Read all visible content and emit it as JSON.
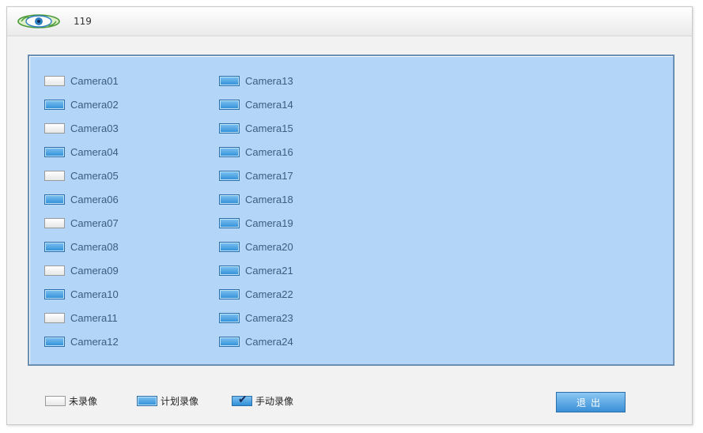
{
  "window": {
    "title": "119"
  },
  "cameras": {
    "column1": [
      {
        "label": "Camera01",
        "status": "none"
      },
      {
        "label": "Camera02",
        "status": "plan"
      },
      {
        "label": "Camera03",
        "status": "none"
      },
      {
        "label": "Camera04",
        "status": "plan"
      },
      {
        "label": "Camera05",
        "status": "none"
      },
      {
        "label": "Camera06",
        "status": "plan"
      },
      {
        "label": "Camera07",
        "status": "none"
      },
      {
        "label": "Camera08",
        "status": "plan"
      },
      {
        "label": "Camera09",
        "status": "none"
      },
      {
        "label": "Camera10",
        "status": "plan"
      },
      {
        "label": "Camera11",
        "status": "none"
      },
      {
        "label": "Camera12",
        "status": "plan"
      }
    ],
    "column2": [
      {
        "label": "Camera13",
        "status": "plan"
      },
      {
        "label": "Camera14",
        "status": "plan"
      },
      {
        "label": "Camera15",
        "status": "plan"
      },
      {
        "label": "Camera16",
        "status": "plan"
      },
      {
        "label": "Camera17",
        "status": "plan"
      },
      {
        "label": "Camera18",
        "status": "plan"
      },
      {
        "label": "Camera19",
        "status": "plan"
      },
      {
        "label": "Camera20",
        "status": "plan"
      },
      {
        "label": "Camera21",
        "status": "plan"
      },
      {
        "label": "Camera22",
        "status": "plan"
      },
      {
        "label": "Camera23",
        "status": "plan"
      },
      {
        "label": "Camera24",
        "status": "plan"
      }
    ]
  },
  "legend": {
    "none_label": "未录像",
    "plan_label": "计划录像",
    "manual_label": "手动录像",
    "check_mark": "✔"
  },
  "buttons": {
    "exit_label": "退出"
  },
  "colors": {
    "panel_bg": "#b3d6f8",
    "panel_border": "#6b8fb3",
    "plan_blue": "#2f8fd7",
    "camera_text": "#3c5d7c"
  },
  "icons": {
    "logo": "eye-logo-icon"
  }
}
